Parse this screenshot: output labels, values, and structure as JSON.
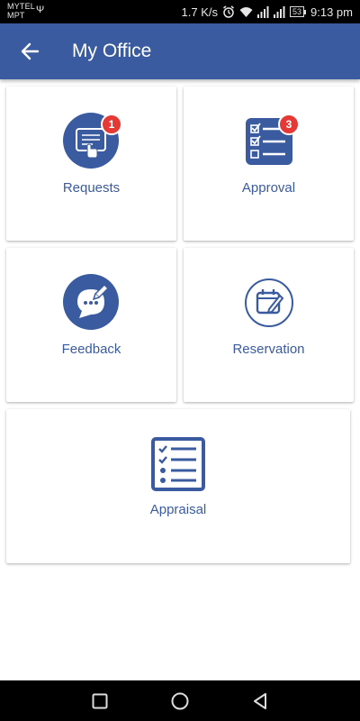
{
  "status_bar": {
    "carrier_line1": "MYTEL",
    "carrier_line2": "MPT",
    "usb_symbol": "Ψ",
    "speed": "1.7 K/s",
    "battery": "53",
    "time": "9:13 pm",
    "icons": [
      "usb-icon",
      "alarm-icon",
      "wifi-icon",
      "signal-icon",
      "signal-icon",
      "battery-icon"
    ]
  },
  "app_bar": {
    "title": "My Office",
    "back_icon": "arrow-left-icon",
    "background_color": "#3a5ba0"
  },
  "tiles": [
    {
      "label": "Requests",
      "icon": "tablet-touch-icon",
      "badge": "1"
    },
    {
      "label": "Approval",
      "icon": "checklist-icon",
      "badge": "3"
    },
    {
      "label": "Feedback",
      "icon": "chat-pencil-icon",
      "badge": null
    },
    {
      "label": "Reservation",
      "icon": "calendar-edit-icon",
      "badge": null
    },
    {
      "label": "Appraisal",
      "icon": "clipboard-list-icon",
      "badge": null
    }
  ],
  "nav_bar": {
    "icons": [
      "recent-apps-icon",
      "home-icon",
      "back-icon"
    ]
  },
  "colors": {
    "primary": "#3a5ba0",
    "badge": "#e53935"
  }
}
